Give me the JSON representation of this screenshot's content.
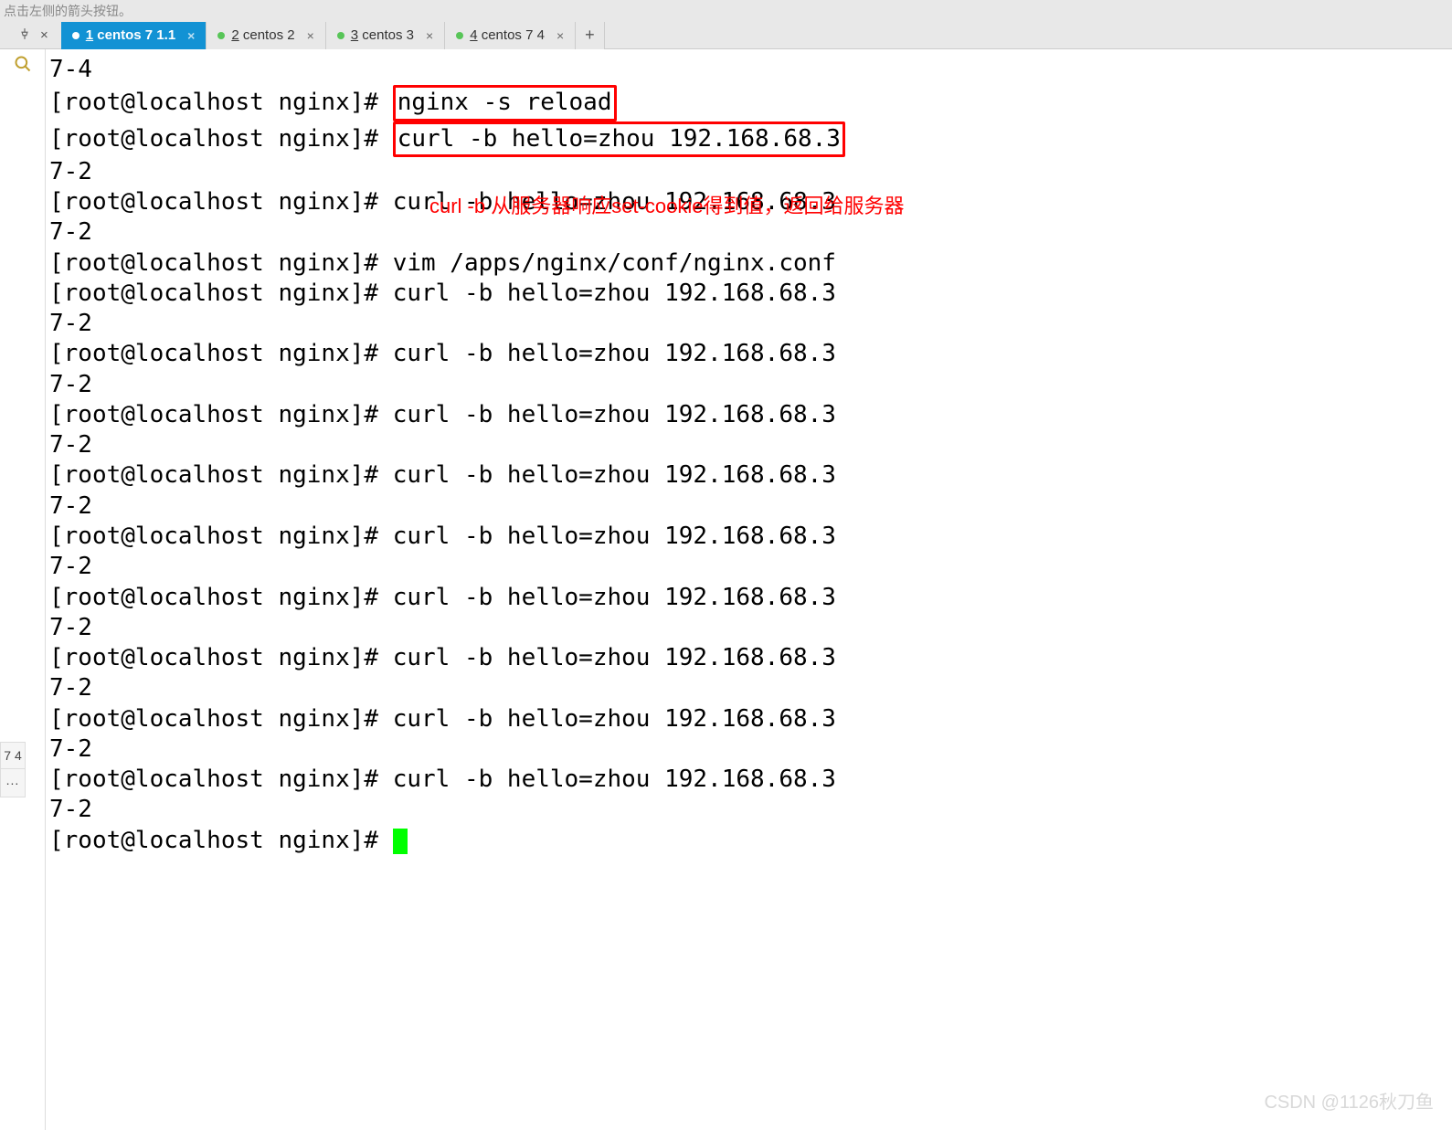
{
  "hint": "点击左侧的箭头按钮。",
  "pin": {
    "icon": "pin-icon",
    "close": "×"
  },
  "tabs": [
    {
      "num": "1",
      "label": "centos 7 1.1",
      "active": true
    },
    {
      "num": "2",
      "label": "centos 2",
      "active": false
    },
    {
      "num": "3",
      "label": "centos 3",
      "active": false
    },
    {
      "num": "4",
      "label": "centos 7 4",
      "active": false
    }
  ],
  "newtab": "+",
  "sidebar": {
    "label_short": "7 4",
    "dots": "..."
  },
  "annotation": "curl -b 从服务器响应set-cookie得到值，返回给服务器",
  "watermark": "CSDN @1126秋刀鱼",
  "term": {
    "l0": "7-4",
    "prompt": "[root@localhost nginx]# ",
    "cmd_reload": "nginx -s reload",
    "cmd_curl": "curl -b hello=zhou 192.168.68.3",
    "cmd_vim": "vim /apps/nginx/conf/nginx.conf",
    "out72": "7-2"
  }
}
